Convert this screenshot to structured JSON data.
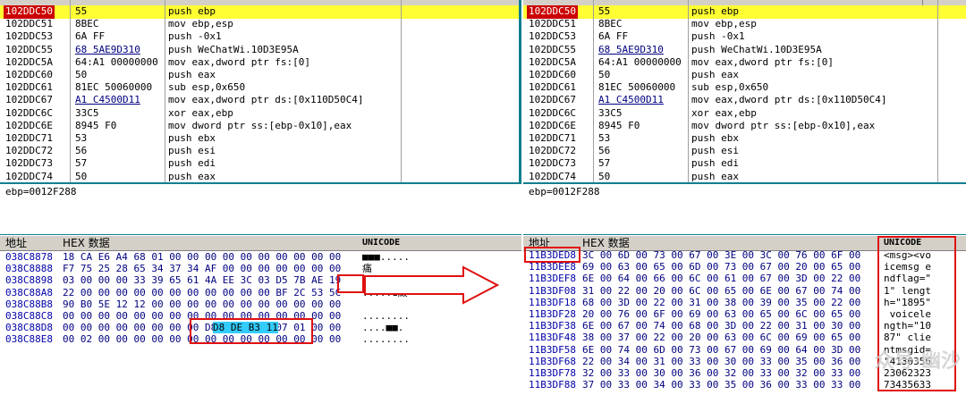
{
  "left": {
    "disasm": [
      {
        "addr": "102DDC50",
        "hex": "55",
        "asm": "push ebp",
        "selected": true
      },
      {
        "addr": "102DDC51",
        "hex": "8BEC",
        "asm": "mov ebp,esp"
      },
      {
        "addr": "102DDC53",
        "hex": "6A FF",
        "asm": "push -0x1"
      },
      {
        "addr": "102DDC55",
        "hex": "68 5AE9D310",
        "asm": "push WeChatWi.10D3E95A",
        "ul": true
      },
      {
        "addr": "102DDC5A",
        "hex": "64:A1 00000000",
        "asm": "mov eax,dword ptr fs:[0]"
      },
      {
        "addr": "102DDC60",
        "hex": "50",
        "asm": "push eax"
      },
      {
        "addr": "102DDC61",
        "hex": "81EC 50060000",
        "asm": "sub esp,0x650"
      },
      {
        "addr": "102DDC67",
        "hex": "A1 C4500D11",
        "asm": "mov eax,dword ptr ds:[0x110D50C4]",
        "ul": true
      },
      {
        "addr": "102DDC6C",
        "hex": "33C5",
        "asm": "xor eax,ebp"
      },
      {
        "addr": "102DDC6E",
        "hex": "8945 F0",
        "asm": "mov dword ptr ss:[ebp-0x10],eax"
      },
      {
        "addr": "102DDC71",
        "hex": "53",
        "asm": "push ebx"
      },
      {
        "addr": "102DDC72",
        "hex": "56",
        "asm": "push esi"
      },
      {
        "addr": "102DDC73",
        "hex": "57",
        "asm": "push edi"
      },
      {
        "addr": "102DDC74",
        "hex": "50",
        "asm": "push eax"
      }
    ],
    "info": "ebp=0012F288",
    "dump_header": {
      "addr": "地址",
      "hex": "HEX 数据",
      "uni": "UNICODE"
    },
    "dump": [
      {
        "addr": "038C8878",
        "hex": "18 CA E6 A4 68 01 00 00 00 00 00 00 00 00 00 00",
        "uni": "■■■....."
      },
      {
        "addr": "038C8888",
        "hex": "F7 75 25 28 65 34 37 34 AF 00 00 00 00 00 00 00",
        "uni": "痛"
      },
      {
        "addr": "038C8898",
        "hex": "03 00 00 00 33 39 65 61 4A EE 3C 03 D5 7B AE 19",
        "uni": ".慥  ■"
      },
      {
        "addr": "038C88A8",
        "hex": "22 00 00 00 00 00 00 00 00 00 00 00 BF 2C 53 5C",
        "uni": ".....1廄"
      },
      {
        "addr": "038C88B8",
        "hex": "90 B0 5E 12 12 00 00 00 00 00 00 00 00 00 00 00",
        "uni": ""
      },
      {
        "addr": "038C88C8",
        "hex": "00 00 00 00 00 00 00 00 00 00 00 00 00 00 00 00",
        "uni": "........"
      },
      {
        "addr": "038C88D8",
        "hex": "00 00 00 00 00 00 00 00 D8 DE B3 11 07 01 00 00",
        "uni": "....■■."
      },
      {
        "addr": "038C88E8",
        "hex": "00 02 00 00 00 00 00 00 00 00 00 00 00 00 00 00",
        "uni": "........"
      }
    ]
  },
  "right": {
    "disasm": [
      {
        "addr": "102DDC50",
        "hex": "55",
        "asm": "push ebp",
        "selected": true
      },
      {
        "addr": "102DDC51",
        "hex": "8BEC",
        "asm": "mov ebp,esp"
      },
      {
        "addr": "102DDC53",
        "hex": "6A FF",
        "asm": "push -0x1"
      },
      {
        "addr": "102DDC55",
        "hex": "68 5AE9D310",
        "asm": "push WeChatWi.10D3E95A",
        "ul": true
      },
      {
        "addr": "102DDC5A",
        "hex": "64:A1 00000000",
        "asm": "mov eax,dword ptr fs:[0]"
      },
      {
        "addr": "102DDC60",
        "hex": "50",
        "asm": "push eax"
      },
      {
        "addr": "102DDC61",
        "hex": "81EC 50060000",
        "asm": "sub esp,0x650"
      },
      {
        "addr": "102DDC67",
        "hex": "A1 C4500D11",
        "asm": "mov eax,dword ptr ds:[0x110D50C4]",
        "ul": true
      },
      {
        "addr": "102DDC6C",
        "hex": "33C5",
        "asm": "xor eax,ebp"
      },
      {
        "addr": "102DDC6E",
        "hex": "8945 F0",
        "asm": "mov dword ptr ss:[ebp-0x10],eax"
      },
      {
        "addr": "102DDC71",
        "hex": "53",
        "asm": "push ebx"
      },
      {
        "addr": "102DDC72",
        "hex": "56",
        "asm": "push esi"
      },
      {
        "addr": "102DDC73",
        "hex": "57",
        "asm": "push edi"
      },
      {
        "addr": "102DDC74",
        "hex": "50",
        "asm": "push eax"
      }
    ],
    "info": "ebp=0012F288",
    "dump_header": {
      "addr": "地址",
      "hex": "HEX 数据",
      "uni": "UNICODE"
    },
    "dump": [
      {
        "addr": "11B3DED8",
        "hex": "3C 00 6D 00 73 00 67 00 3E 00 3C 00 76 00 6F 00",
        "uni": "<msg><vo"
      },
      {
        "addr": "11B3DEE8",
        "hex": "69 00 63 00 65 00 6D 00 73 00 67 00 20 00 65 00",
        "uni": "icemsg e"
      },
      {
        "addr": "11B3DEF8",
        "hex": "6E 00 64 00 66 00 6C 00 61 00 67 00 3D 00 22 00",
        "uni": "ndflag=\""
      },
      {
        "addr": "11B3DF08",
        "hex": "31 00 22 00 20 00 6C 00 65 00 6E 00 67 00 74 00",
        "uni": "1\" lengt"
      },
      {
        "addr": "11B3DF18",
        "hex": "68 00 3D 00 22 00 31 00 38 00 39 00 35 00 22 00",
        "uni": "h=\"1895\""
      },
      {
        "addr": "11B3DF28",
        "hex": "20 00 76 00 6F 00 69 00 63 00 65 00 6C 00 65 00",
        "uni": " voicele"
      },
      {
        "addr": "11B3DF38",
        "hex": "6E 00 67 00 74 00 68 00 3D 00 22 00 31 00 30 00",
        "uni": "ngth=\"10"
      },
      {
        "addr": "11B3DF48",
        "hex": "38 00 37 00 22 00 20 00 63 00 6C 00 69 00 65 00",
        "uni": "87\" clie"
      },
      {
        "addr": "11B3DF58",
        "hex": "6E 00 74 00 6D 00 73 00 67 00 69 00 64 00 3D 00",
        "uni": "ntmsgid="
      },
      {
        "addr": "11B3DF68",
        "hex": "22 00 34 00 31 00 33 00 30 00 33 00 35 00 36 00",
        "uni": "\"4130356"
      },
      {
        "addr": "11B3DF78",
        "hex": "32 00 33 00 30 00 36 00 32 00 33 00 32 00 33 00",
        "uni": "23062323"
      },
      {
        "addr": "11B3DF88",
        "hex": "37 00 33 00 34 00 33 00 35 00 36 00 33 00 33 00",
        "uni": "73435633"
      }
    ]
  },
  "watermark": "众号·幽沙",
  "colors": {
    "selection": "#ffff33",
    "selected_addr_bg": "#cc0000",
    "highlight": "#33ccff",
    "annotation": "#e01010",
    "separator": "#0f7f8f"
  }
}
